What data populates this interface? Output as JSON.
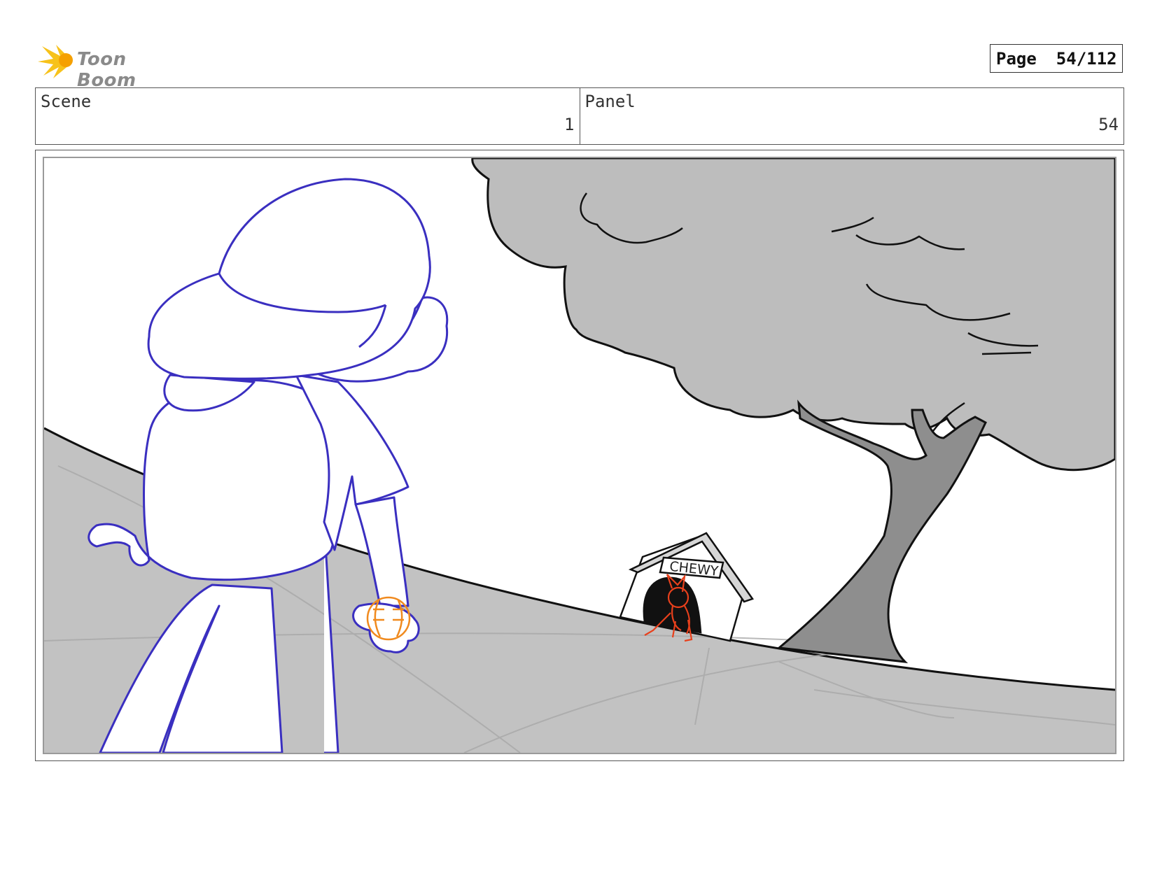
{
  "header": {
    "logo_text": "Toon Boom",
    "page_label": "Page",
    "page_value": "54/112"
  },
  "info": {
    "scene_label": "Scene",
    "scene_value": "1",
    "panel_label": "Panel",
    "panel_value": "54"
  },
  "artwork": {
    "doghouse_sign": "CHEWY",
    "colors": {
      "character_line": "#3a2fc0",
      "ball_line": "#f08a1e",
      "dog_line": "#e8401c",
      "ground_fill": "#c2c2c2",
      "foliage_fill": "#bdbdbd",
      "trunk_fill": "#8e8e8e"
    }
  }
}
